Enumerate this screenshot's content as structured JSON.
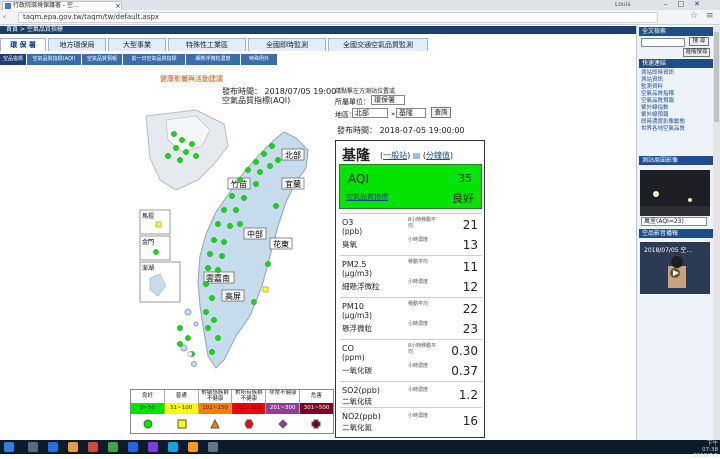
{
  "browser": {
    "tab_title": "行政院環境保護署 - 空...",
    "user": "Louis",
    "url": "taqm.epa.gov.tw/taqm/tw/default.aspx"
  },
  "header": {
    "breadcrumb": "首頁 > 空氣品質指標"
  },
  "top_tabs": [
    "環 保 署",
    "地方環保局",
    "大型事業",
    "特殊性工業區",
    "全國即時監測",
    "全國交通空氣品質監測"
  ],
  "sub_tabs": [
    "空品指標",
    "空氣品質指標(AQI)",
    "空氣品質預報",
    "前一日空氣品質指標",
    "細懸浮微粒濃度",
    "特殊例外"
  ],
  "main": {
    "health_link": "健康影響與活動建議",
    "publish_time": "發布時間： 2018/07/05 19:00",
    "index_title": "空氣品質指標(AQI)"
  },
  "map": {
    "regions": [
      "北部",
      "竹苗",
      "宜蘭",
      "中部",
      "花東",
      "雲嘉南",
      "高屏"
    ],
    "islands": [
      "馬祖",
      "金門",
      "澎湖"
    ]
  },
  "legend": {
    "labels": [
      "良好",
      "普通",
      "對敏感族群不健康",
      "對所有族群不健康",
      "非常不健康",
      "危害"
    ],
    "ranges": [
      "0~50",
      "51~100",
      "101~150",
      "151~200",
      "201~300",
      "301~500"
    ],
    "colors": [
      "#00e400",
      "#ffff00",
      "#ff7e00",
      "#ff0000",
      "#8f3f97",
      "#7e0023"
    ]
  },
  "selector": {
    "hint": "請點擊左方測站位置或",
    "unit_label": "所屬單位：",
    "unit_value": "環保署",
    "area_label": "地區：",
    "region_value": "北部",
    "station_value": "基隆",
    "query_button": "查詢"
  },
  "panel": {
    "time": "發布時間： 2018-07-05 19:00:00",
    "station": "基隆",
    "link_general": "一般站",
    "link_minute": "分鐘值",
    "aqi_label": "AQI",
    "aqi_value": "35",
    "aqi_link": "空氣品質指標",
    "aqi_status": "良好",
    "pollutants": [
      {
        "name1": "O3",
        "sub": "",
        "unit": "(ppb)",
        "name2": "臭氧",
        "rows": [
          {
            "avg": "8小時移動平均",
            "value": "21"
          },
          {
            "avg": "小時濃度",
            "value": "13"
          }
        ]
      },
      {
        "name1": "PM2.5",
        "sub": "",
        "unit": "(μg/m3)",
        "name2": "細懸浮微粒",
        "rows": [
          {
            "avg": "移動平均",
            "value": "11"
          },
          {
            "avg": "小時濃度",
            "value": "12"
          }
        ]
      },
      {
        "name1": "PM10",
        "sub": "",
        "unit": "(μg/m3)",
        "name2": "懸浮微粒",
        "rows": [
          {
            "avg": "移動平均",
            "value": "22"
          },
          {
            "avg": "小時濃度",
            "value": "23"
          }
        ]
      },
      {
        "name1": "CO",
        "sub": "",
        "unit": "(ppm)",
        "name2": "一氧化碳",
        "rows": [
          {
            "avg": "8小時移動平均",
            "value": "0.30"
          },
          {
            "avg": "小時濃度",
            "value": "0.37"
          }
        ]
      },
      {
        "name1": "SO2(ppb)",
        "sub": "",
        "unit": "",
        "name2": "二氧化硫",
        "rows": [
          {
            "avg": "小時濃度",
            "value": "1.2"
          }
        ]
      },
      {
        "name1": "NO2(ppb)",
        "sub": "",
        "unit": "",
        "name2": "二氧化氮",
        "rows": [
          {
            "avg": "小時濃度",
            "value": "16"
          }
        ]
      }
    ]
  },
  "sidebar": {
    "search_title": "全文檢索",
    "search_button": "搜 尋",
    "adv_search_button": "進階搜尋",
    "quick_title": "快速連結",
    "quick_links": [
      "測站即時資訊",
      "測站資訊",
      "監測資料",
      "空氣品質指標",
      "空氣品質預報",
      "紫外線指數",
      "紫外線預報",
      "即時濃度影像動態",
      "世界各地空氣品質"
    ],
    "camera_title": "測站周圍影像",
    "camera_select": "萬里(AQI=23)",
    "video_title": "空品影音播報",
    "video_caption": "2018/07/05 空..."
  },
  "taskbar": {
    "time": "下午 07:38",
    "date": "2018/7/5"
  }
}
